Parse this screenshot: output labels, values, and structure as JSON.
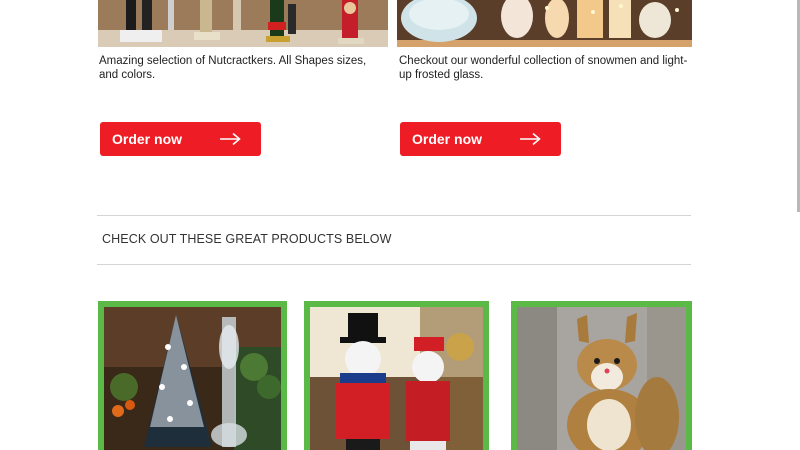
{
  "colors": {
    "accent_red": "#ee1c24",
    "card_border_green": "#5bb947",
    "divider": "#d4d4d4",
    "text": "#222222"
  },
  "promos": [
    {
      "image_alt": "nutcrackers-photo",
      "description": "Amazing selection of Nutcractkers. All Shapes sizes, and colors.",
      "button_label": "Order now",
      "button_icon": "arrow-right-icon"
    },
    {
      "image_alt": "frosted-glass-snowmen-photo",
      "description": "Checkout our wonderful collection of snowmen and light-up frosted glass.",
      "button_label": "Order now",
      "button_icon": "arrow-right-icon"
    }
  ],
  "section": {
    "heading": "CHECK OUT THESE GREAT PRODUCTS BELOW"
  },
  "products": [
    {
      "image_alt": "frosted-christmas-tree-photo"
    },
    {
      "image_alt": "snowman-couple-figures-photo"
    },
    {
      "image_alt": "squirrel-figure-photo"
    }
  ]
}
